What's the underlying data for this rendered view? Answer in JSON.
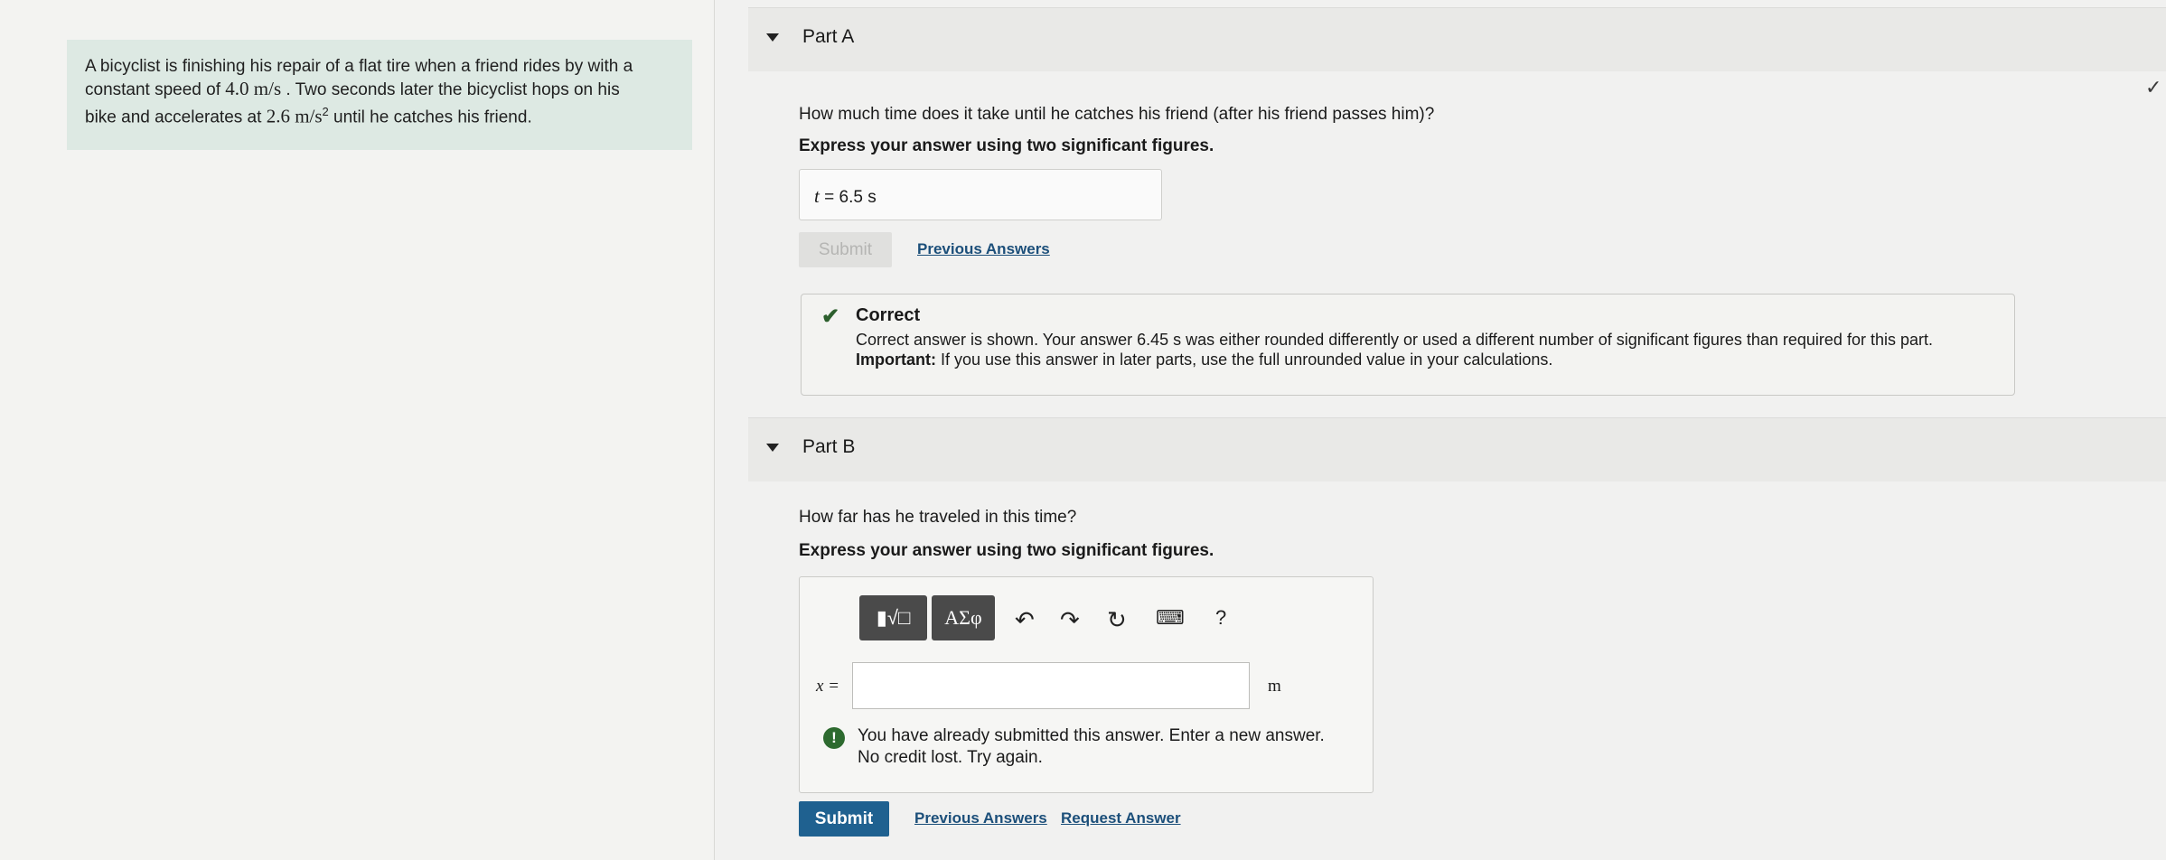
{
  "problem": {
    "line1": "A bicyclist is finishing his repair of a flat tire when a friend rides by with a",
    "line2_a": "constant speed of ",
    "line2_speed": "4.0 m/s",
    "line2_b": " . Two seconds later the bicyclist hops on his",
    "line3_a": "bike and accelerates at ",
    "line3_acc": "2.6 m/s",
    "line3_exp": "2",
    "line3_b": " until he catches his friend."
  },
  "part_a": {
    "title": "Part A",
    "question": "How much time does it take until he catches his friend (after his friend passes him)?",
    "instruction": "Express your answer using two significant figures.",
    "answer_var": "t",
    "answer_eq": " =  6.5  s",
    "submit_label": "Submit",
    "previous_answers": "Previous Answers",
    "feedback": {
      "title": "Correct",
      "line1": "Correct answer is shown. Your answer 6.45 s was either rounded differently or used a different number of significant figures than required for this part.",
      "important_label": "Important:",
      "line2": " If you use this answer in later parts, use the full unrounded value in your calculations."
    }
  },
  "part_b": {
    "title": "Part B",
    "question": "How far has he traveled in this time?",
    "instruction": "Express your answer using two significant figures.",
    "toolbar": {
      "templates_label": "▮√□",
      "symbols_label": "ΑΣφ",
      "undo_icon": "↶",
      "redo_icon": "↷",
      "reset_icon": "↻",
      "keyboard_icon": "⌨",
      "help_label": "?"
    },
    "input_var": "x =",
    "input_value": "",
    "unit": "m",
    "warning_line1": "You have already submitted this answer. Enter a new answer.",
    "warning_line2": "No credit lost. Try again.",
    "submit_label": "Submit",
    "previous_answers": "Previous Answers",
    "request_answer": "Request Answer"
  }
}
